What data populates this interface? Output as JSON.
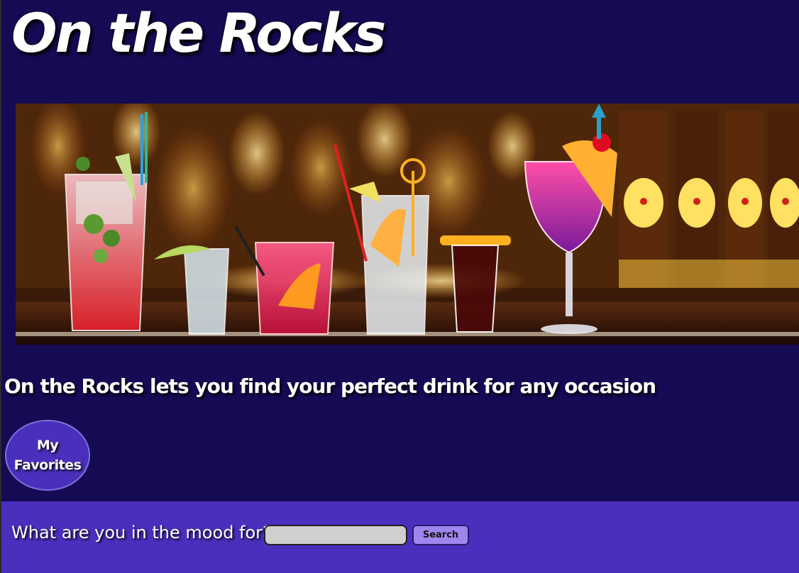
{
  "header": {
    "title": "On the Rocks"
  },
  "hero": {
    "alt": "Cocktails lined up on a bar counter"
  },
  "main": {
    "tagline": "On the Rocks lets you find your perfect drink for any occasion",
    "favorites_label": "My Favorites"
  },
  "search": {
    "label": "What are you in the mood for?",
    "input_value": "",
    "placeholder": "",
    "button_label": "Search"
  },
  "colors": {
    "page_background": "#150a54",
    "accent_purple": "#4a2fbd",
    "search_button": "#9f86ee",
    "text": "#ffffff"
  }
}
